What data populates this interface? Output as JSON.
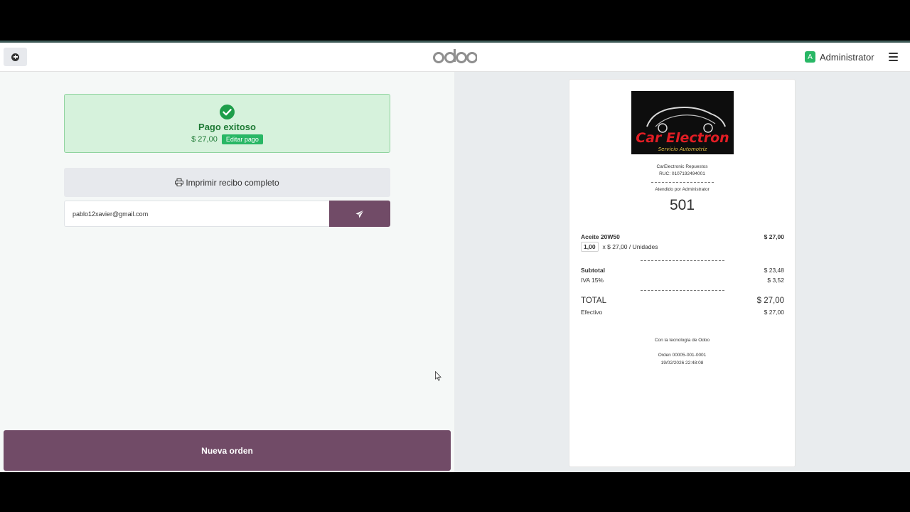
{
  "navbar": {
    "logo_text": "odoo",
    "user_initial": "A",
    "user_name": "Administrator"
  },
  "payment": {
    "title": "Pago exitoso",
    "amount": "$ 27,00",
    "edit_label": "Editar pago",
    "print_label": "Imprimir recibo completo",
    "email_value": "pablo12xavier@gmail.com",
    "new_order_label": "Nueva orden"
  },
  "receipt": {
    "logo_text_main": "Car Electron",
    "logo_text_sub": "Servicio Automotriz",
    "company": "CarElectronic Repuestos",
    "ruc": "RUC: 0107192494001",
    "served_by": "Atendido por Administrator",
    "order_number": "501",
    "product_name": "Aceite 20W50",
    "product_total": "$ 27,00",
    "product_qty": "1,00",
    "product_unit": "x $ 27,00 / Unidades",
    "subtotal_label": "Subtotal",
    "subtotal_value": "$ 23,48",
    "tax_label": "IVA 15%",
    "tax_value": "$ 3,52",
    "total_label": "TOTAL",
    "total_value": "$ 27,00",
    "cash_label": "Efectivo",
    "cash_value": "$ 27,00",
    "powered_by": "Con la tecnología de Odoo",
    "order_ref": "Orden 00005-001-0001",
    "datetime": "19/02/2026 22:48:08"
  },
  "colors": {
    "primary": "#714b67",
    "success": "#28b765",
    "success_bg": "#d6f2dc"
  }
}
